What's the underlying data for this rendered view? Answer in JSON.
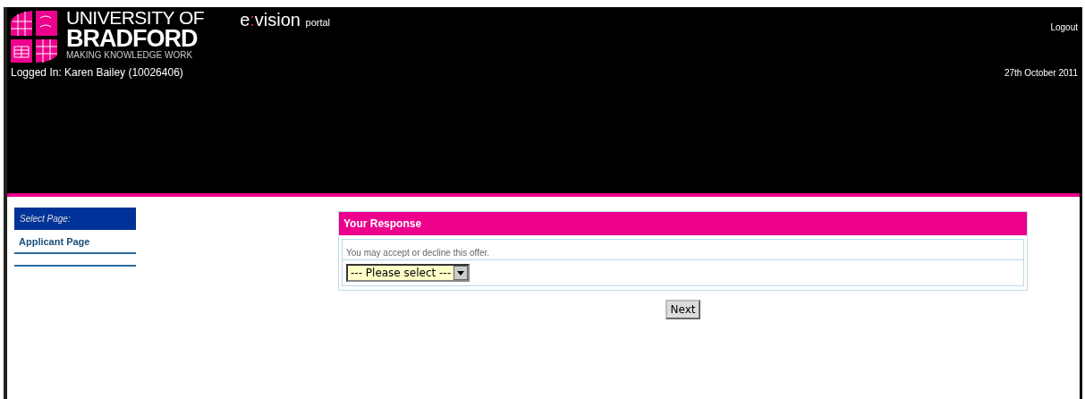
{
  "header": {
    "logo": {
      "line_1": "UNIVERSITY OF",
      "line_2": "BRADFORD",
      "tagline": "MAKING KNOWLEDGE WORK"
    },
    "portal": {
      "brand_left": "e",
      "brand_sep": ":",
      "brand_right": "vision",
      "suffix": "portal"
    },
    "logout": "Logout",
    "logged_in": "Logged In: Karen Bailey (10026406)",
    "date": "27th October 2011"
  },
  "sidebar": {
    "title": "Select Page:",
    "items": [
      {
        "label": "Applicant Page",
        "selected": false
      }
    ]
  },
  "panel": {
    "title": "Your Response",
    "message": "You may accept or decline this offer.",
    "select": {
      "value": "--- Please select ---"
    }
  },
  "buttons": [
    {
      "label": "Next"
    }
  ]
}
